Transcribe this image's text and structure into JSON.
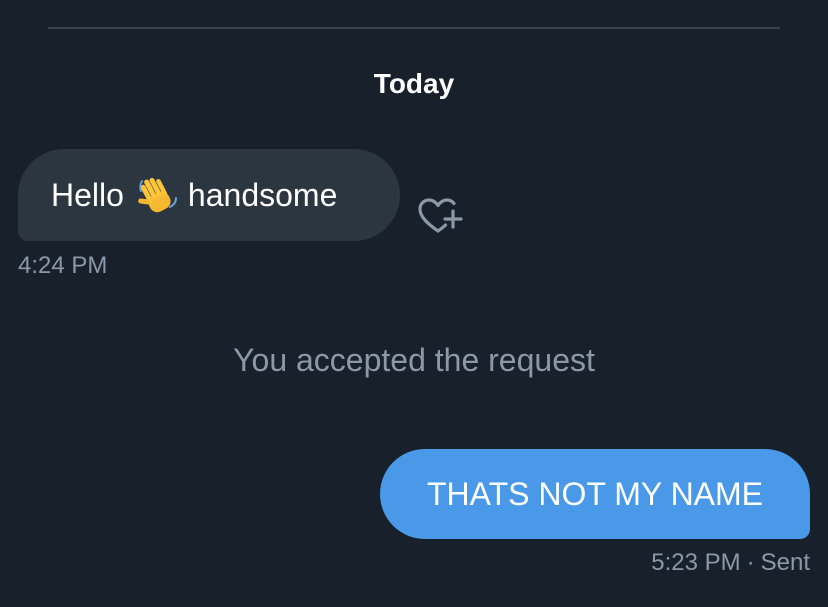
{
  "conversation": {
    "date_header": "Today",
    "messages": [
      {
        "direction": "incoming",
        "text_before": "Hello",
        "emoji": "waving-hand-icon",
        "text_after": "handsome",
        "time": "4:24 PM"
      },
      {
        "direction": "outgoing",
        "text": "THATS NOT MY NAME",
        "time": "5:23 PM",
        "separator": "·",
        "status": "Sent"
      }
    ],
    "system_message": "You accepted the request"
  },
  "colors": {
    "background": "#18202b",
    "incoming_bubble": "#2c3640",
    "outgoing_bubble": "#4a99e9",
    "muted_text": "#8b98a5",
    "divider": "#38444d"
  },
  "icons": {
    "reaction": "heart-plus-icon"
  }
}
